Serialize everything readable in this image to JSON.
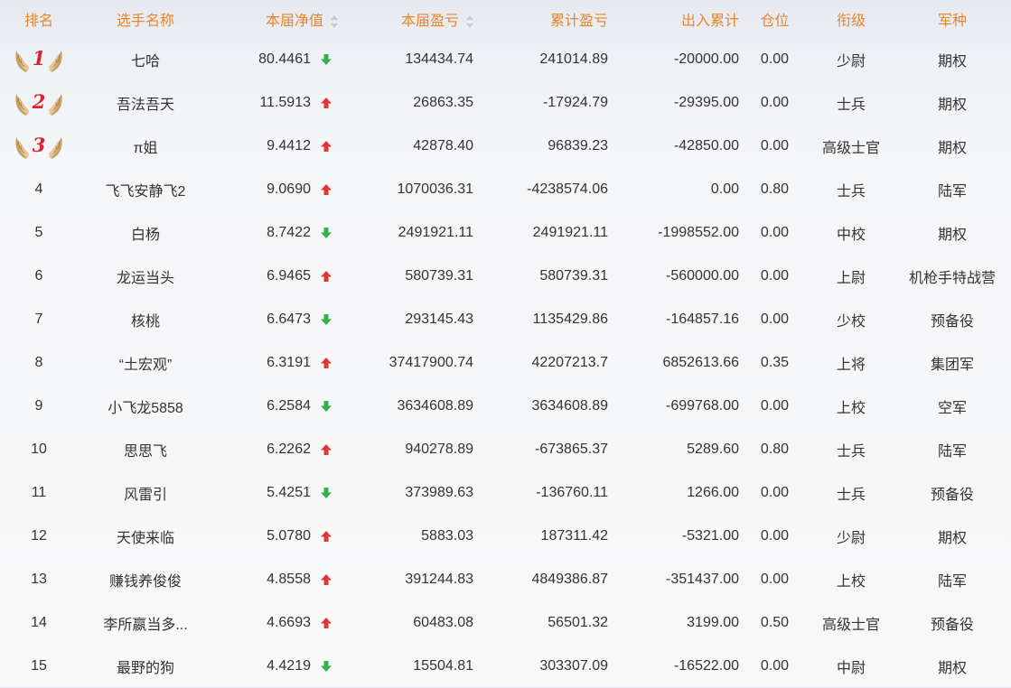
{
  "colors": {
    "header_text": "#e8852a",
    "arrow_up": "#e23a33",
    "arrow_down": "#33b24a",
    "medal_number": "#d9262c",
    "medal_wing": "#c8a064"
  },
  "headers": {
    "rank": "排名",
    "name": "选手名称",
    "net": "本届净值",
    "pnl": "本届盈亏",
    "cum_pnl": "累计盈亏",
    "inout": "出入累计",
    "position": "仓位",
    "title": "衔级",
    "branch": "军种"
  },
  "rows": [
    {
      "rank": "1",
      "medal": true,
      "name": "七哈",
      "net": "80.4461",
      "trend": "down",
      "pnl": "134434.74",
      "cum_pnl": "241014.89",
      "inout": "-20000.00",
      "position": "0.00",
      "title": "少尉",
      "branch": "期权"
    },
    {
      "rank": "2",
      "medal": true,
      "name": "吾法吾天",
      "net": "11.5913",
      "trend": "up",
      "pnl": "26863.35",
      "cum_pnl": "-17924.79",
      "inout": "-29395.00",
      "position": "0.00",
      "title": "士兵",
      "branch": "期权"
    },
    {
      "rank": "3",
      "medal": true,
      "name": "π姐",
      "net": "9.4412",
      "trend": "up",
      "pnl": "42878.40",
      "cum_pnl": "96839.23",
      "inout": "-42850.00",
      "position": "0.00",
      "title": "高级士官",
      "branch": "期权"
    },
    {
      "rank": "4",
      "medal": false,
      "name": "飞飞安静飞2",
      "net": "9.0690",
      "trend": "up",
      "pnl": "1070036.31",
      "cum_pnl": "-4238574.06",
      "inout": "0.00",
      "position": "0.80",
      "title": "士兵",
      "branch": "陆军"
    },
    {
      "rank": "5",
      "medal": false,
      "name": "白杨",
      "net": "8.7422",
      "trend": "down",
      "pnl": "2491921.11",
      "cum_pnl": "2491921.11",
      "inout": "-1998552.00",
      "position": "0.00",
      "title": "中校",
      "branch": "期权"
    },
    {
      "rank": "6",
      "medal": false,
      "name": "龙运当头",
      "net": "6.9465",
      "trend": "up",
      "pnl": "580739.31",
      "cum_pnl": "580739.31",
      "inout": "-560000.00",
      "position": "0.00",
      "title": "上尉",
      "branch": "机枪手特战营"
    },
    {
      "rank": "7",
      "medal": false,
      "name": "核桃",
      "net": "6.6473",
      "trend": "down",
      "pnl": "293145.43",
      "cum_pnl": "1135429.86",
      "inout": "-164857.16",
      "position": "0.00",
      "title": "少校",
      "branch": "预备役"
    },
    {
      "rank": "8",
      "medal": false,
      "name": "“土宏观”",
      "net": "6.3191",
      "trend": "up",
      "pnl": "37417900.74",
      "cum_pnl": "42207213.7",
      "inout": "6852613.66",
      "position": "0.35",
      "title": "上将",
      "branch": "集团军"
    },
    {
      "rank": "9",
      "medal": false,
      "name": "小飞龙5858",
      "net": "6.2584",
      "trend": "down",
      "pnl": "3634608.89",
      "cum_pnl": "3634608.89",
      "inout": "-699768.00",
      "position": "0.00",
      "title": "上校",
      "branch": "空军"
    },
    {
      "rank": "10",
      "medal": false,
      "name": "思思飞",
      "net": "6.2262",
      "trend": "up",
      "pnl": "940278.89",
      "cum_pnl": "-673865.37",
      "inout": "5289.60",
      "position": "0.80",
      "title": "士兵",
      "branch": "陆军"
    },
    {
      "rank": "11",
      "medal": false,
      "name": "风雷引",
      "net": "5.4251",
      "trend": "down",
      "pnl": "373989.63",
      "cum_pnl": "-136760.11",
      "inout": "1266.00",
      "position": "0.00",
      "title": "士兵",
      "branch": "预备役"
    },
    {
      "rank": "12",
      "medal": false,
      "name": "天使来临",
      "net": "5.0780",
      "trend": "up",
      "pnl": "5883.03",
      "cum_pnl": "187311.42",
      "inout": "-5321.00",
      "position": "0.00",
      "title": "少尉",
      "branch": "期权"
    },
    {
      "rank": "13",
      "medal": false,
      "name": "赚钱养俊俊",
      "net": "4.8558",
      "trend": "up",
      "pnl": "391244.83",
      "cum_pnl": "4849386.87",
      "inout": "-351437.00",
      "position": "0.00",
      "title": "上校",
      "branch": "陆军"
    },
    {
      "rank": "14",
      "medal": false,
      "name": "李所嬴当多...",
      "net": "4.6693",
      "trend": "up",
      "pnl": "60483.08",
      "cum_pnl": "56501.32",
      "inout": "3199.00",
      "position": "0.50",
      "title": "高级士官",
      "branch": "预备役"
    },
    {
      "rank": "15",
      "medal": false,
      "name": "最野的狗",
      "net": "4.4219",
      "trend": "down",
      "pnl": "15504.81",
      "cum_pnl": "303307.09",
      "inout": "-16522.00",
      "position": "0.00",
      "title": "中尉",
      "branch": "期权"
    }
  ]
}
